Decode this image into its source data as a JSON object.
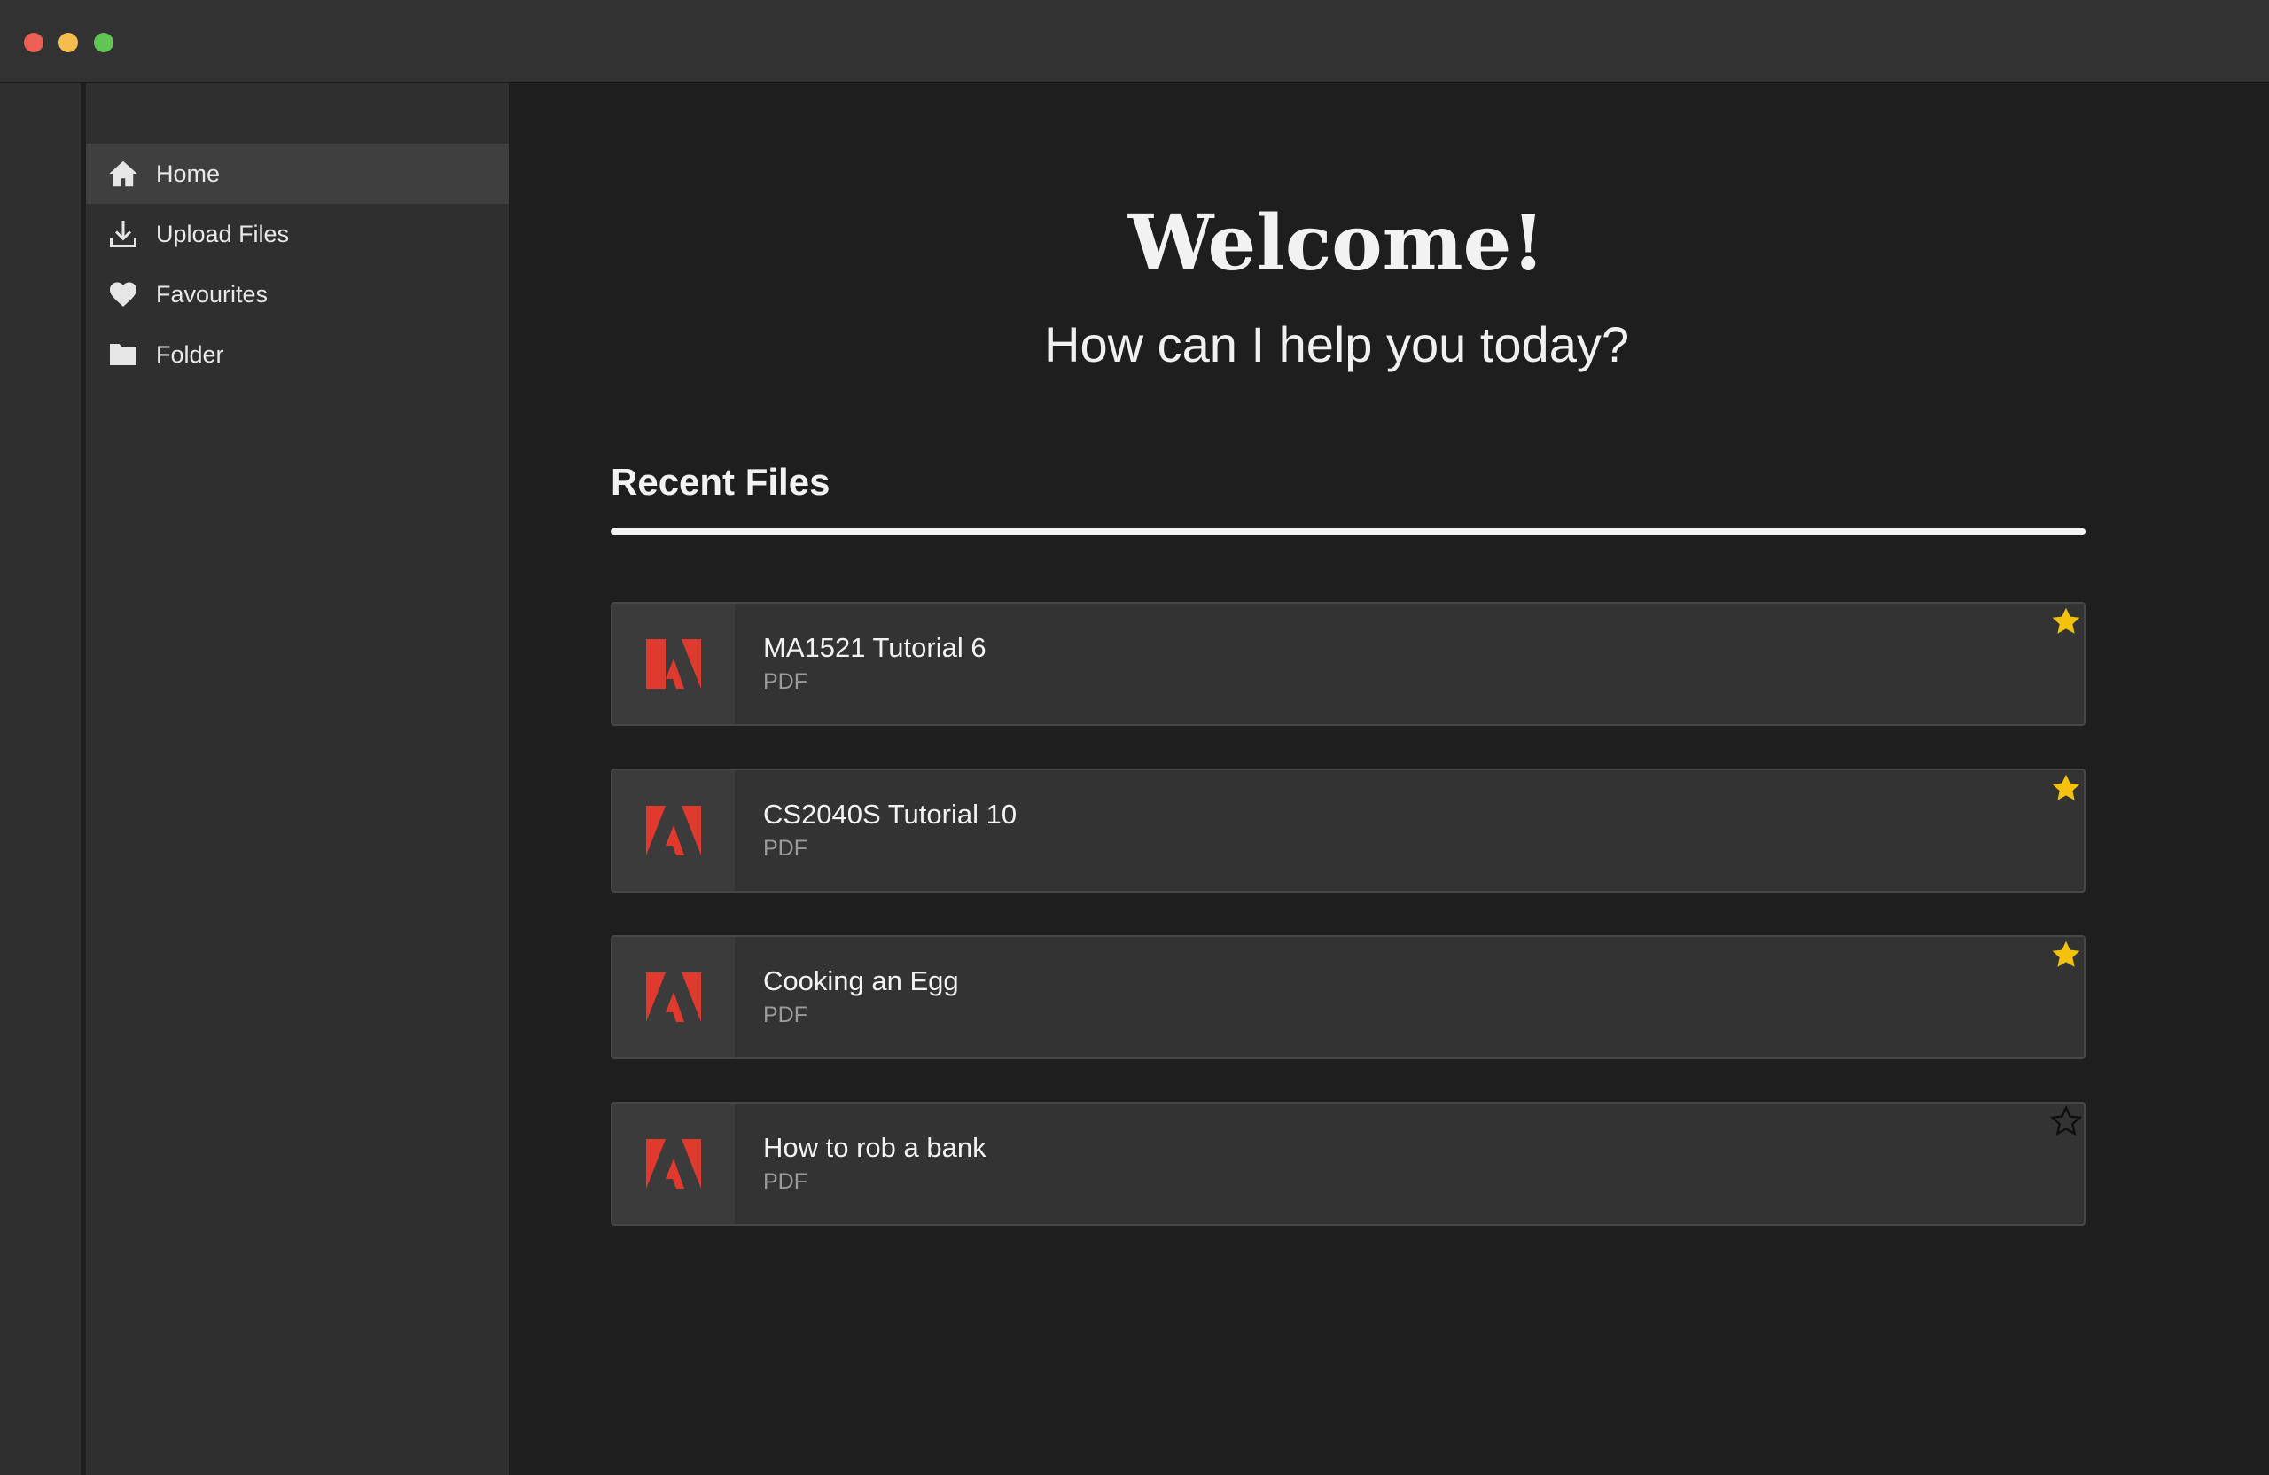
{
  "window": {
    "controls": [
      "close",
      "minimize",
      "zoom"
    ]
  },
  "sidebar": {
    "items": [
      {
        "label": "Home",
        "icon": "home-icon",
        "active": true
      },
      {
        "label": "Upload Files",
        "icon": "download-icon",
        "active": false
      },
      {
        "label": "Favourites",
        "icon": "heart-icon",
        "active": false
      },
      {
        "label": "Folder",
        "icon": "folder-icon",
        "active": false
      }
    ]
  },
  "main": {
    "title": "Welcome!",
    "subtitle": "How can I help you today?",
    "recent_heading": "Recent Files",
    "files": [
      {
        "name": "MA1521 Tutorial 6",
        "type": "PDF",
        "icon": "adobe-pdf-icon",
        "favourite": true
      },
      {
        "name": "CS2040S Tutorial 10",
        "type": "PDF",
        "icon": "adobe-pdf-icon",
        "favourite": true
      },
      {
        "name": "Cooking an Egg",
        "type": "PDF",
        "icon": "adobe-pdf-icon",
        "favourite": true
      },
      {
        "name": "How to rob a bank",
        "type": "PDF",
        "icon": "adobe-pdf-icon",
        "favourite": false
      }
    ]
  },
  "colors": {
    "background": "#1e1e1e",
    "sidebar": "#2f2f2f",
    "active_item": "#3f3f3f",
    "card": "#333333",
    "adobe_red": "#e03a2f",
    "star_gold": "#f4c20d"
  }
}
